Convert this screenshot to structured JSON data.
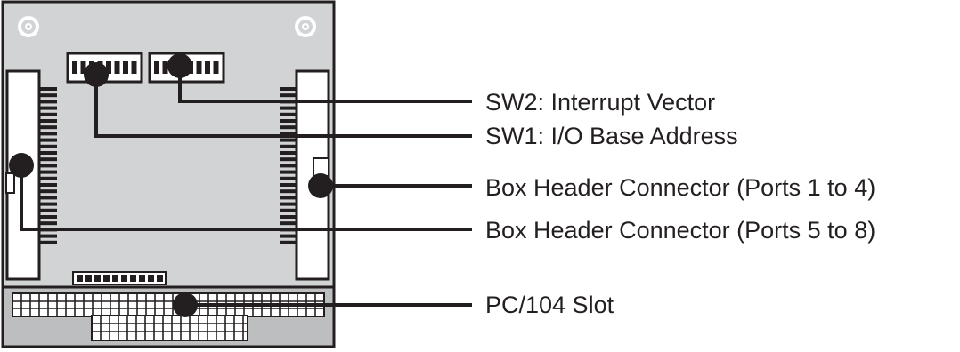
{
  "callouts": [
    {
      "id": "sw2",
      "text": "SW2: Interrupt Vector"
    },
    {
      "id": "sw1",
      "text": "SW1: I/O Base Address"
    },
    {
      "id": "hdr-1-4",
      "text": "Box Header Connector (Ports 1 to 4)"
    },
    {
      "id": "hdr-5-8",
      "text": "Box Header Connector (Ports 5 to 8)"
    },
    {
      "id": "pc104",
      "text": "PC/104 Slot"
    }
  ],
  "colors": {
    "board": "#d1d3d4",
    "outline": "#231f20",
    "component": "#ffffff",
    "marker": "#231f20",
    "text": "#231f20"
  }
}
